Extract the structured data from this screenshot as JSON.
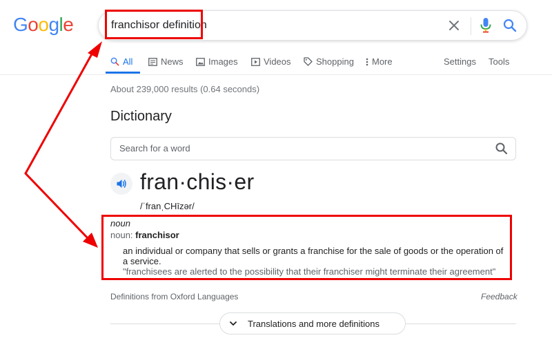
{
  "logo": {
    "letters": [
      "G",
      "o",
      "o",
      "g",
      "l",
      "e"
    ],
    "colors": [
      "#4285f4",
      "#ea4335",
      "#fbbc05",
      "#4285f4",
      "#34a853",
      "#ea4335"
    ]
  },
  "search": {
    "query": "franchisor definition"
  },
  "tabs": [
    {
      "label": "All",
      "icon": "search-icon",
      "active": true
    },
    {
      "label": "News",
      "icon": "news-icon"
    },
    {
      "label": "Images",
      "icon": "image-icon"
    },
    {
      "label": "Videos",
      "icon": "video-icon"
    },
    {
      "label": "Shopping",
      "icon": "tag-icon"
    },
    {
      "label": "More",
      "icon": "more-vert-icon"
    }
  ],
  "tools": {
    "settings": "Settings",
    "tools": "Tools"
  },
  "result_stats": "About 239,000 results (0.64 seconds)",
  "dictionary": {
    "title": "Dictionary",
    "search_placeholder": "Search for a word",
    "headword": "fran·chis·er",
    "phonetic": "/ˈfranˌCHīzər/",
    "part_of_speech": "noun",
    "noun_prefix": "noun:",
    "noun_variant": "franchisor",
    "definition": "an individual or company that sells or grants a franchise for the sale of goods or the operation of a service.",
    "example": "\"franchisees are alerted to the possibility that their franchiser might terminate their agreement\"",
    "source": "Definitions from Oxford Languages",
    "feedback": "Feedback",
    "more_button": "Translations and more definitions"
  },
  "colors": {
    "accent": "#1a73e8",
    "annotation": "#ee0000"
  }
}
